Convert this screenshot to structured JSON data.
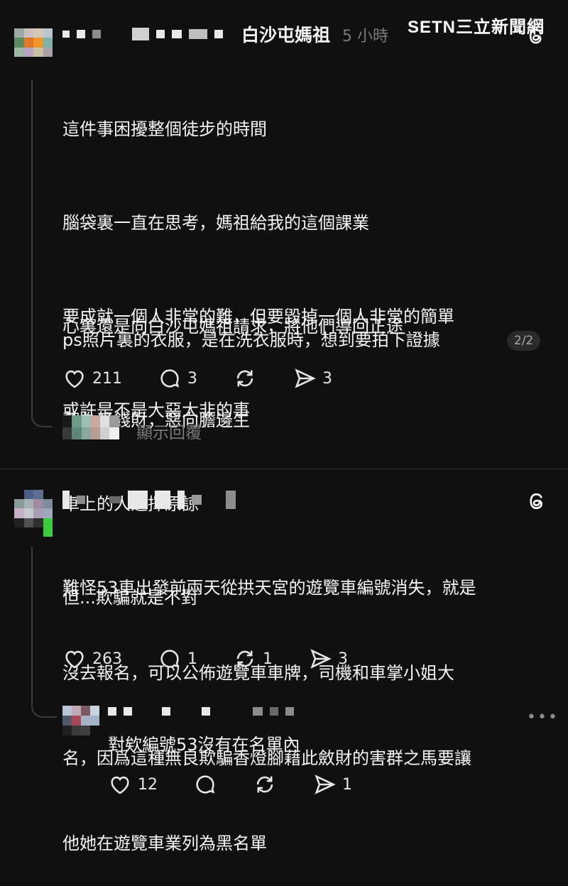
{
  "watermark": {
    "text": "SETN三立新聞網"
  },
  "post1": {
    "handle": "白沙屯媽祖",
    "time": "5 小時",
    "lines": [
      "這件事困擾整個徒步的時間",
      "腦袋裏一直在思考，媽祖給我的這個課業",
      "要成就一個人非常的難，但要毀掉一個人非常的簡單",
      "或許是不是大惡大非的事",
      "車上的人選擇原諒",
      "但...欺騙就是不對"
    ],
    "lines2": [
      "心裏還是向白沙屯媽祖請求，將他們導回正途",
      "莫為了錢財，惡向膽邊生"
    ],
    "ps": "ps照片裏的衣服，是在洗衣服時，想到要拍下證據",
    "page_badge": "2/2",
    "likes": "211",
    "comments": "3",
    "shares": "3",
    "show_replies": "顯示回覆"
  },
  "post2": {
    "lines": [
      "難怪53車出發前兩天從拱天宮的遊覽車編號消失，就是",
      "沒去報名，可以公佈遊覽車車牌，司機和車掌小姐大",
      "名，因爲這種無良欺騙香燈腳藉此斂財的害群之馬要讓",
      "他她在遊覽車業列為黑名單"
    ],
    "likes": "263",
    "comments": "1",
    "reposts": "1",
    "shares": "3"
  },
  "reply": {
    "text": "對欸編號53沒有在名單內",
    "likes": "12",
    "shares": "1"
  },
  "colors": {
    "background": "#101010",
    "text": "#f3f5f7",
    "muted": "#7a7a7a",
    "line": "#3a3a3a"
  }
}
